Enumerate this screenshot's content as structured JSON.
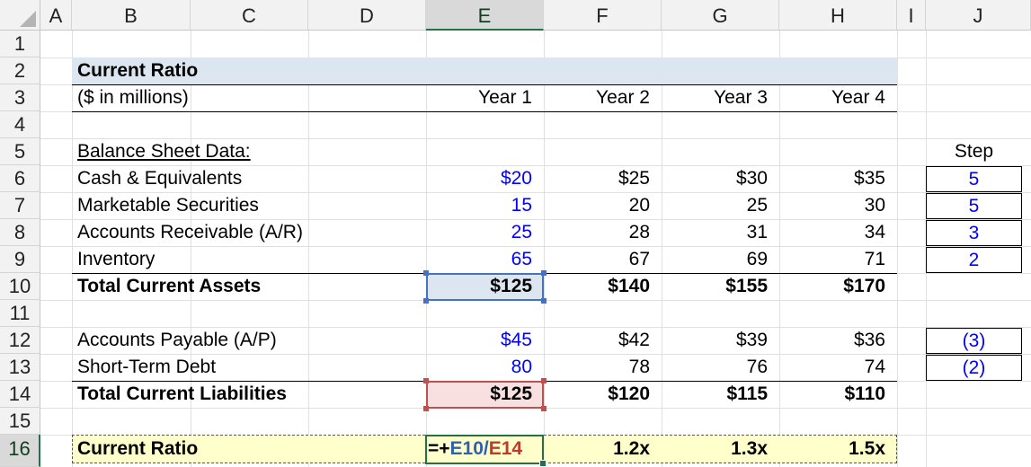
{
  "columns": [
    "A",
    "B",
    "C",
    "D",
    "E",
    "F",
    "G",
    "H",
    "I",
    "J"
  ],
  "selected_column": "E",
  "rows": [
    "1",
    "2",
    "3",
    "4",
    "5",
    "6",
    "7",
    "8",
    "9",
    "10",
    "11",
    "12",
    "13",
    "14",
    "15",
    "16"
  ],
  "selected_row": "16",
  "sheet": {
    "title": "Current Ratio",
    "units": "($ in millions)",
    "years": [
      "Year 1",
      "Year 2",
      "Year 3",
      "Year 4"
    ],
    "section_label": "Balance Sheet Data:",
    "step_header": "Step",
    "assets": [
      {
        "label": "Cash & Equivalents",
        "values": [
          "$20",
          "$25",
          "$30",
          "$35"
        ],
        "step": "5"
      },
      {
        "label": "Marketable Securities",
        "values": [
          "15",
          "20",
          "25",
          "30"
        ],
        "step": "5"
      },
      {
        "label": "Accounts Receivable (A/R)",
        "values": [
          "25",
          "28",
          "31",
          "34"
        ],
        "step": "3"
      },
      {
        "label": "Inventory",
        "values": [
          "65",
          "67",
          "69",
          "71"
        ],
        "step": "2"
      }
    ],
    "total_assets": {
      "label": "Total Current Assets",
      "values": [
        "$125",
        "$140",
        "$155",
        "$170"
      ]
    },
    "liabilities": [
      {
        "label": "Accounts Payable (A/P)",
        "values": [
          "$45",
          "$42",
          "$39",
          "$36"
        ],
        "step": "(3)"
      },
      {
        "label": "Short-Term Debt",
        "values": [
          "80",
          "78",
          "76",
          "74"
        ],
        "step": "(2)"
      }
    ],
    "total_liabilities": {
      "label": "Total Current Liabilities",
      "values": [
        "$125",
        "$120",
        "$115",
        "$110"
      ]
    },
    "ratio": {
      "label": "Current Ratio",
      "formula_prefix": "=+",
      "formula_ref1": "E10",
      "formula_op": "/",
      "formula_ref2": "E14",
      "values": [
        "1.2x",
        "1.3x",
        "1.5x"
      ]
    }
  },
  "colors": {
    "input_blue": "#0000ff",
    "title_band": "#dce6f1",
    "ratio_band": "#ffffcc",
    "ref1_highlight": "#dce6f1",
    "ref2_highlight": "#f8e0e0",
    "ref1_text": "#2f5fb3",
    "ref2_text": "#c0392b",
    "selection_green": "#217346"
  }
}
